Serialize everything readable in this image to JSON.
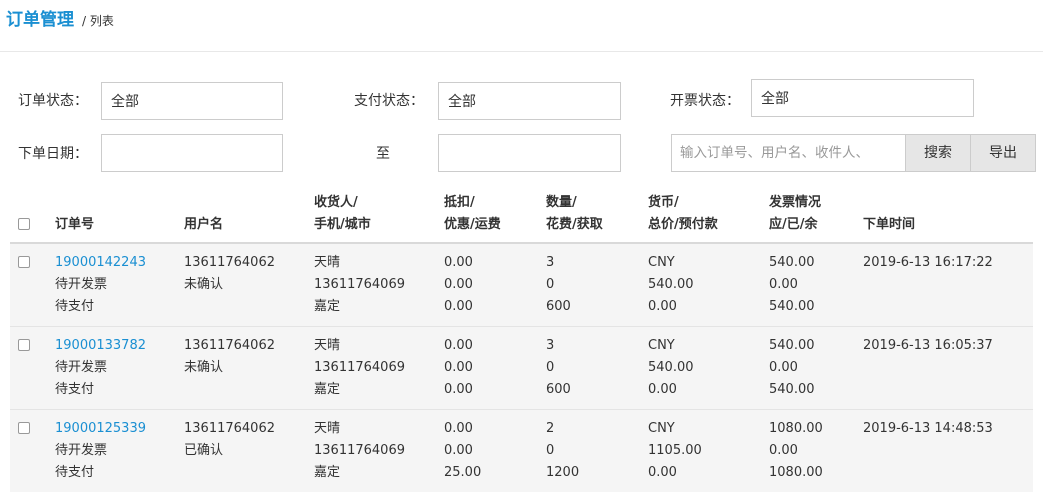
{
  "header": {
    "title": "订单管理",
    "crumb": "/ 列表"
  },
  "filters": {
    "order_status_label": "订单状态：",
    "order_status_value": "全部",
    "pay_status_label": "支付状态：",
    "pay_status_value": "全部",
    "invoice_status_label": "开票状态：",
    "invoice_status_value": "全部",
    "order_date_label": "下单日期：",
    "date_to_label": "至",
    "date_from_value": "",
    "date_to_value": "",
    "search_placeholder": "输入订单号、用户名、收件人、",
    "search_button": "搜索",
    "export_button": "导出"
  },
  "table": {
    "headers": {
      "order_no": "订单号",
      "user": "用户名",
      "recv_1": "收货人/",
      "recv_2": "手机/城市",
      "disc_1": "抵扣/",
      "disc_2": "优惠/运费",
      "qty_1": "数量/",
      "qty_2": "花费/获取",
      "cur_1": "货币/",
      "cur_2": "总价/预付款",
      "inv_1": "发票情况",
      "inv_2": "应/已/余",
      "time": "下单时间"
    },
    "rows": [
      {
        "order_no": "19000142243",
        "invoice_state": "待开发票",
        "pay_state": "待支付",
        "user": "13611764062",
        "confirm": "未确认",
        "receiver": "天晴",
        "phone": "13611764069",
        "city": "嘉定",
        "deduct": "0.00",
        "discount": "0.00",
        "freight": "0.00",
        "qty": "3",
        "spend": "0",
        "earn": "600",
        "currency": "CNY",
        "total": "540.00",
        "prepaid": "0.00",
        "inv_due": "540.00",
        "inv_done": "0.00",
        "inv_left": "540.00",
        "time": "2019-6-13 16:17:22"
      },
      {
        "order_no": "19000133782",
        "invoice_state": "待开发票",
        "pay_state": "待支付",
        "user": "13611764062",
        "confirm": "未确认",
        "receiver": "天晴",
        "phone": "13611764069",
        "city": "嘉定",
        "deduct": "0.00",
        "discount": "0.00",
        "freight": "0.00",
        "qty": "3",
        "spend": "0",
        "earn": "600",
        "currency": "CNY",
        "total": "540.00",
        "prepaid": "0.00",
        "inv_due": "540.00",
        "inv_done": "0.00",
        "inv_left": "540.00",
        "time": "2019-6-13 16:05:37"
      },
      {
        "order_no": "19000125339",
        "invoice_state": "待开发票",
        "pay_state": "待支付",
        "user": "13611764062",
        "confirm": "已确认",
        "receiver": "天晴",
        "phone": "13611764069",
        "city": "嘉定",
        "deduct": "0.00",
        "discount": "0.00",
        "freight": "25.00",
        "qty": "2",
        "spend": "0",
        "earn": "1200",
        "currency": "CNY",
        "total": "1105.00",
        "prepaid": "0.00",
        "inv_due": "1080.00",
        "inv_done": "0.00",
        "inv_left": "1080.00",
        "time": "2019-6-13 14:48:53"
      }
    ]
  },
  "colors": {
    "accent": "#1a8fd2",
    "row_bg": "#f5f5f5",
    "button_bg": "#e6e6e6"
  }
}
